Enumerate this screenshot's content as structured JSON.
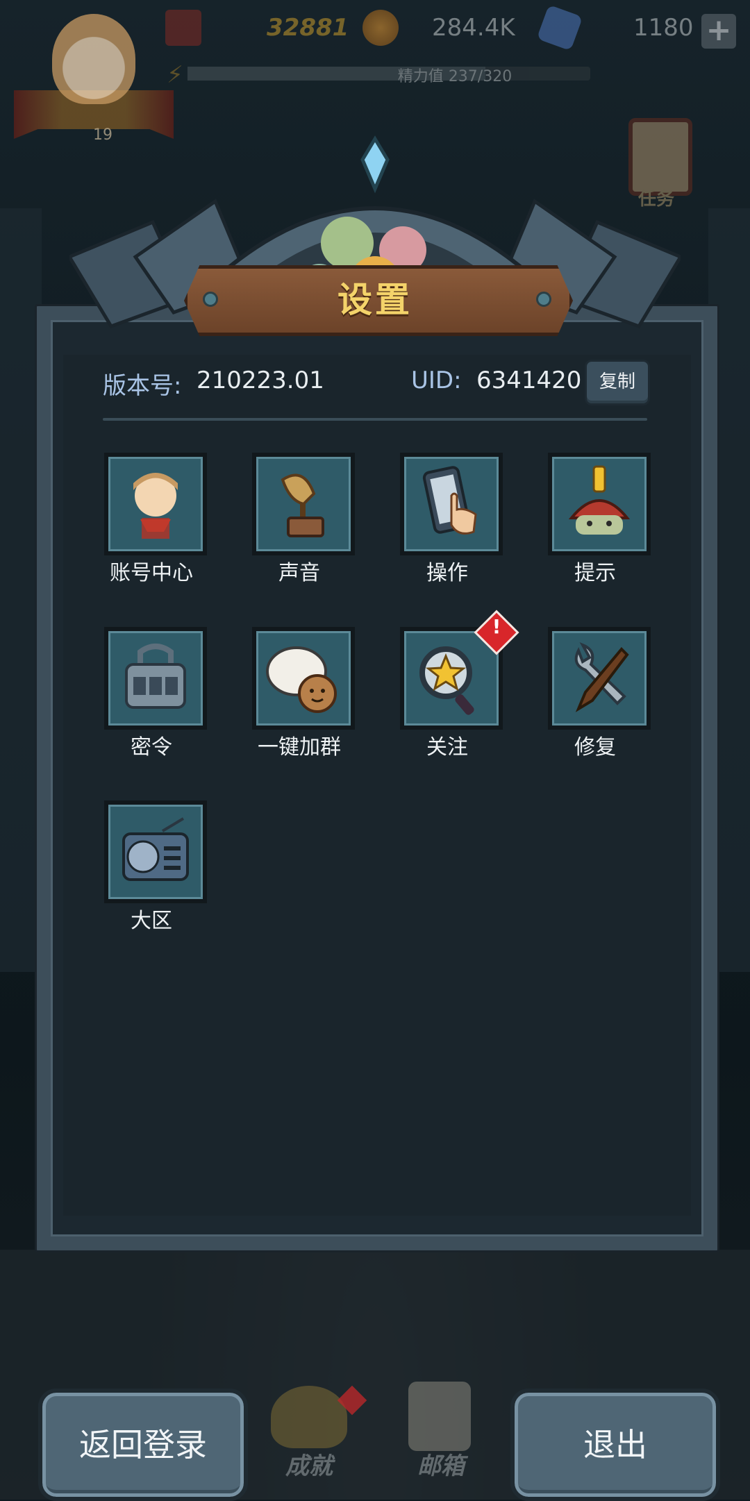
{
  "hud": {
    "level": "19",
    "coins": "32881",
    "gold": "284.4K",
    "gems": "1180",
    "plus_label": "+",
    "stamina_text": "精力值 237/320",
    "stamina_fraction": 0.74,
    "quest_label": "任务"
  },
  "panel": {
    "title": "设置",
    "version_label": "版本号:",
    "version_value": "210223.01",
    "uid_label": "UID:",
    "uid_value": "6341420",
    "copy_label": "复制"
  },
  "items": [
    {
      "label": "账号中心",
      "icon": "account-icon"
    },
    {
      "label": "声音",
      "icon": "gramophone-icon"
    },
    {
      "label": "操作",
      "icon": "phone-touch-icon"
    },
    {
      "label": "提示",
      "icon": "hint-icon"
    },
    {
      "label": "密令",
      "icon": "lock-icon"
    },
    {
      "label": "一键加群",
      "icon": "chat-group-icon"
    },
    {
      "label": "关注",
      "icon": "magnifier-star-icon",
      "alert": "!"
    },
    {
      "label": "修复",
      "icon": "tools-icon"
    },
    {
      "label": "大区",
      "icon": "radio-icon"
    }
  ],
  "bottom": {
    "back_login": "返回登录",
    "exit": "退出",
    "achievements": "成就",
    "mail": "邮箱"
  },
  "colors": {
    "accent_title": "#f4d36a",
    "label_blue": "#a9c4e6",
    "tile": "#2f5b68",
    "alert_red": "#d8262a"
  }
}
